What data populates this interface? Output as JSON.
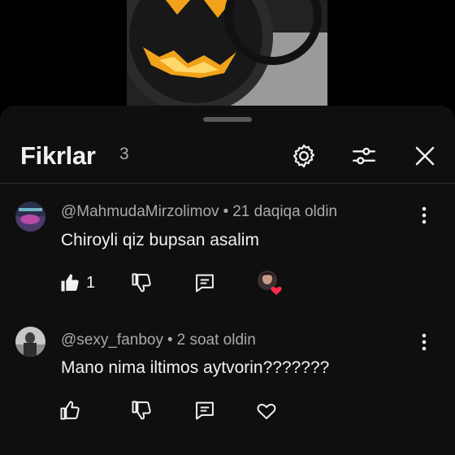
{
  "video": {
    "thumbnail_icon": "jack-o-lantern-image"
  },
  "comments_panel": {
    "title": "Fikrlar",
    "count": "3",
    "icons": {
      "settings": "gear-icon",
      "filter": "sliders-icon",
      "close": "close-icon"
    }
  },
  "comments": [
    {
      "author": "@MahmudaMirzolimov",
      "time": "21 daqiqa oldin",
      "text": "Chiroyli qiz bupsan asalim",
      "likes": "1",
      "liked": true,
      "creator_heart": true
    },
    {
      "author": "@sexy_fanboy",
      "time": "2 soat oldin",
      "text": "Mano nima iltimos aytvorin???????",
      "likes": "",
      "liked": false,
      "creator_heart": false
    }
  ],
  "colors": {
    "sheet_bg": "#0f0f0f",
    "text": "#f1f1f1",
    "muted": "#aaaaaa",
    "heart": "#ff2a4f"
  }
}
